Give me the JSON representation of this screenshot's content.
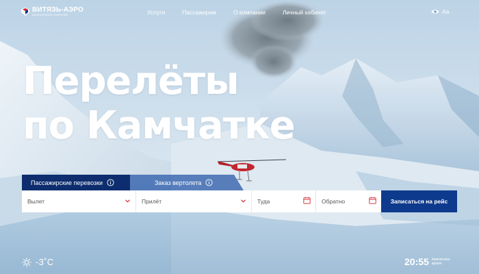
{
  "brand": {
    "name": "ВИТЯЗЬ-АЭРО",
    "subtitle": "АВИАЦИОННАЯ КОМПАНИЯ",
    "accent_color": "#d22630",
    "primary_color": "#0d3a8c"
  },
  "nav": {
    "items": [
      {
        "label": "Услуги"
      },
      {
        "label": "Пассажирам"
      },
      {
        "label": "О компании"
      },
      {
        "label": "Личный кабинет"
      }
    ],
    "a11y_label": "Aa",
    "a11y_icon": "eye-icon"
  },
  "hero": {
    "title_line1": "Перелёты",
    "title_line2": "по Камчатке"
  },
  "tabs": {
    "active": "Пассажирские перевозки",
    "inactive": "Заказ вертолета",
    "icon": "info-icon"
  },
  "form": {
    "from_placeholder": "Вылет",
    "to_placeholder": "Прилёт",
    "date_there_placeholder": "Туда",
    "date_back_placeholder": "Обратно",
    "submit_label": "Записаться на рейс"
  },
  "footer": {
    "temperature": "-3˚C",
    "weather_icon": "sun-icon",
    "time": "20:55",
    "time_label": "Камчатское время"
  }
}
